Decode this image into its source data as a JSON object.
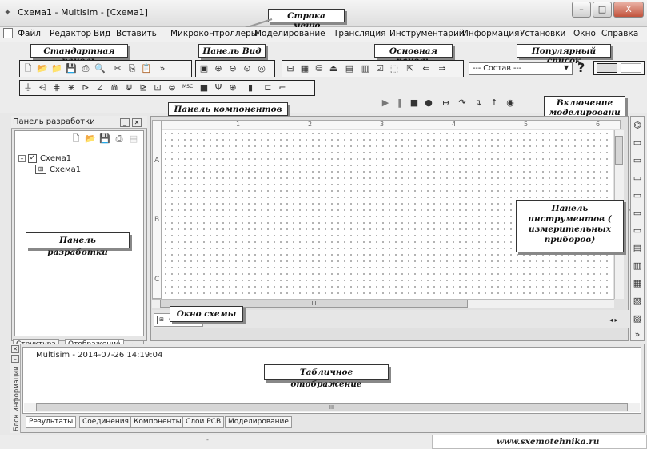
{
  "window": {
    "title": "Схема1 - Multisim - [Схема1]",
    "minimize": "–",
    "maximize": "□",
    "close": "X"
  },
  "menu": {
    "items": [
      "Файл",
      "Редактор",
      "Вид",
      "Вставить",
      "Микроконтроллеры",
      "Моделирование",
      "Трансляция",
      "Инструментарий",
      "Информация",
      "Установки",
      "Окно",
      "Справка"
    ]
  },
  "callouts": {
    "menu_bar": "Строка меню",
    "standard_panel": "Стандартная панель",
    "view_panel": "Панель Вид",
    "main_panel": "Основная панель",
    "popular_list": "Популярный список",
    "components_panel": "Панель компонентов",
    "sim_switch": "Включение моделировани",
    "design_panel": "Панель разработки",
    "schematic_window": "Окно схемы",
    "instruments_panel": "Панель инструментов ( измерительных приборов)",
    "spreadsheet_view": "Табличное отображение"
  },
  "toolbar": {
    "popular_dropdown": "--- Состав ---",
    "help": "?",
    "msc": "MSC"
  },
  "design_panel": {
    "title": "Панель разработки",
    "tree_root": "Схема1",
    "tree_child": "Схема1",
    "tabs": [
      "Структура",
      "Отображение"
    ]
  },
  "schematic": {
    "tab": "Схема1",
    "ruler_rows": [
      "A",
      "B",
      "C"
    ],
    "ruler_cols": [
      "1",
      "2",
      "3",
      "4",
      "5",
      "6"
    ],
    "hscroll": "III"
  },
  "bottom": {
    "log_line": "Multisim  -  2014-07-26 14:19:04",
    "side_label": "Блок информации",
    "tabs": [
      "Результаты",
      "Соединения",
      "Компоненты",
      "Слои PCB",
      "Моделирование"
    ],
    "hscroll": "III"
  },
  "watermark": "www.sxemotehnika.ru"
}
